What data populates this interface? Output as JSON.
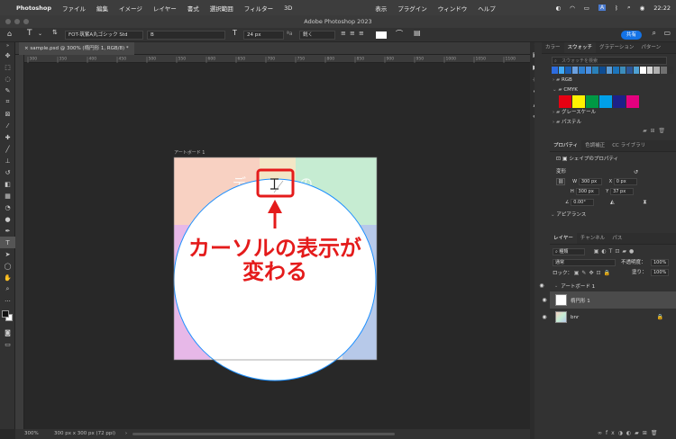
{
  "menubar": {
    "app_name": "Photoshop",
    "items": [
      "ファイル",
      "編集",
      "イメージ",
      "レイヤー",
      "書式",
      "選択範囲",
      "フィルター",
      "3D",
      "表示",
      "プラグイン",
      "ウィンドウ",
      "ヘルプ"
    ],
    "clock": "22:22"
  },
  "window": {
    "title": "Adobe Photoshop 2023"
  },
  "options_bar": {
    "font_family": "FOT-筑紫A丸ゴシック Std",
    "font_style": "B",
    "font_size": "24 px",
    "antialias": "鋭く",
    "share_label": "共有"
  },
  "document_tab": {
    "label": "sample.psd @ 300% (楕円形 1, RGB/8) *"
  },
  "ruler_ticks": [
    "300",
    "350",
    "400",
    "450",
    "500",
    "550",
    "600",
    "650",
    "700",
    "750",
    "800",
    "850",
    "900",
    "950",
    "1000",
    "1050",
    "1100"
  ],
  "canvas": {
    "artboard_label": "アートボード 1",
    "annotation_line1": "カーソルの表示が",
    "annotation_line2": "変わる",
    "annotation_color": "#e41b1b",
    "circle_stroke": "#1e90ff"
  },
  "status": {
    "zoom": "300%",
    "doc_size": "300 px x 300 px (72 ppi)"
  },
  "swatches_panel": {
    "tabs": [
      "カラー",
      "スウォッチ",
      "グラデーション",
      "パターン"
    ],
    "active_tab": "スウォッチ",
    "search_placeholder": "スウォッチを検索",
    "recent_colors": [
      "#2d6cdf",
      "#3fa9f5",
      "#1a5fb4",
      "#6aa0e0",
      "#2f80d0",
      "#4a90e2",
      "#2980b9",
      "#0e4c92",
      "#5b9bd5",
      "#1c75bc",
      "#3c8dbc",
      "#2b5797",
      "#4ea1d3",
      "#ffffff",
      "#d8d8d8",
      "#b0b0b0",
      "#707070",
      "#303030"
    ],
    "groups": [
      "RGB",
      "CMYK",
      "グレースケール",
      "パステル"
    ],
    "cmyk_colors": [
      "#e60012",
      "#fff100",
      "#009944",
      "#00a0e9",
      "#1d2088",
      "#e4007f"
    ]
  },
  "properties_panel": {
    "tabs": [
      "プロパティ",
      "色調補正",
      "CC ライブラリ"
    ],
    "active_tab": "プロパティ",
    "shape_label": "シェイプのプロパティ",
    "transform_label": "変形",
    "w_label": "W",
    "w_value": "300 px",
    "x_label": "X",
    "x_value": "0 px",
    "h_label": "H",
    "h_value": "300 px",
    "y_label": "Y",
    "y_value": "37 px",
    "angle_value": "0.00°",
    "appearance_label": "アピアランス"
  },
  "layers_panel": {
    "tabs": [
      "レイヤー",
      "チャンネル",
      "パス"
    ],
    "active_tab": "レイヤー",
    "filter_label": "種類",
    "blend_mode": "通常",
    "opacity_label": "不透明度：",
    "opacity_value": "100%",
    "lock_label": "ロック：",
    "fill_label": "塗り：",
    "fill_value": "100%",
    "layers": [
      {
        "name": "アートボード 1"
      },
      {
        "name": "楕円形 1"
      },
      {
        "name": "bnr"
      }
    ]
  }
}
